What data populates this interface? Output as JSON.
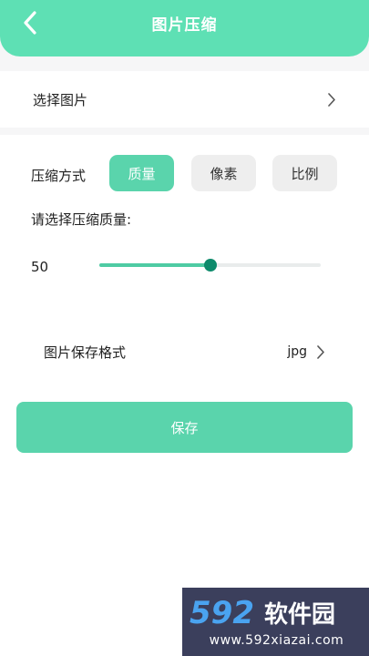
{
  "header": {
    "title": "图片压缩",
    "back_icon": "chevron-left-icon",
    "bg_color": "#5ee0b4"
  },
  "select_image": {
    "label": "选择图片",
    "chevron_icon": "chevron-right-icon"
  },
  "compression": {
    "method_label": "压缩方式",
    "modes": [
      {
        "label": "质量",
        "active": true
      },
      {
        "label": "像素",
        "active": false
      },
      {
        "label": "比例",
        "active": false
      }
    ],
    "quality_prompt": "请选择压缩质量:",
    "slider": {
      "value": "50",
      "fraction": 0.5
    },
    "accent_color": "#5ad4ac",
    "thumb_color": "#0d8a6b"
  },
  "format": {
    "label": "图片保存格式",
    "value": "jpg",
    "chevron_icon": "chevron-right-icon"
  },
  "save_button": {
    "label": "保存"
  },
  "watermark": {
    "brand": "592软件园",
    "url": "www.592xiazai.com"
  }
}
